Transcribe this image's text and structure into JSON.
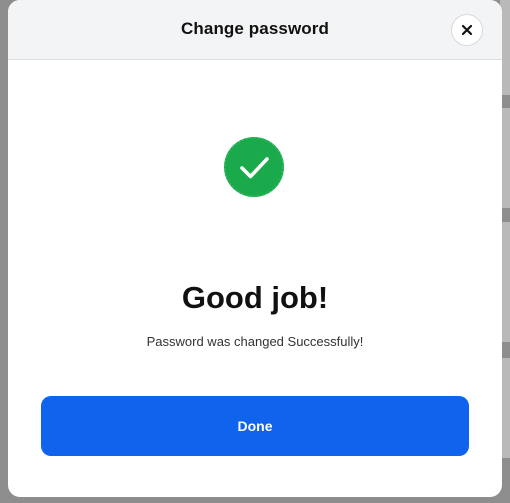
{
  "modal": {
    "title": "Change password",
    "close_icon": "close-icon",
    "success_icon": "check-circle-icon",
    "headline": "Good job!",
    "message": "Password was changed Successfully!",
    "done_label": "Done"
  },
  "colors": {
    "success_green": "#1aa94b",
    "primary_blue": "#0f63ec",
    "header_bg": "#f3f4f5",
    "backdrop": "#8d8d8d"
  }
}
